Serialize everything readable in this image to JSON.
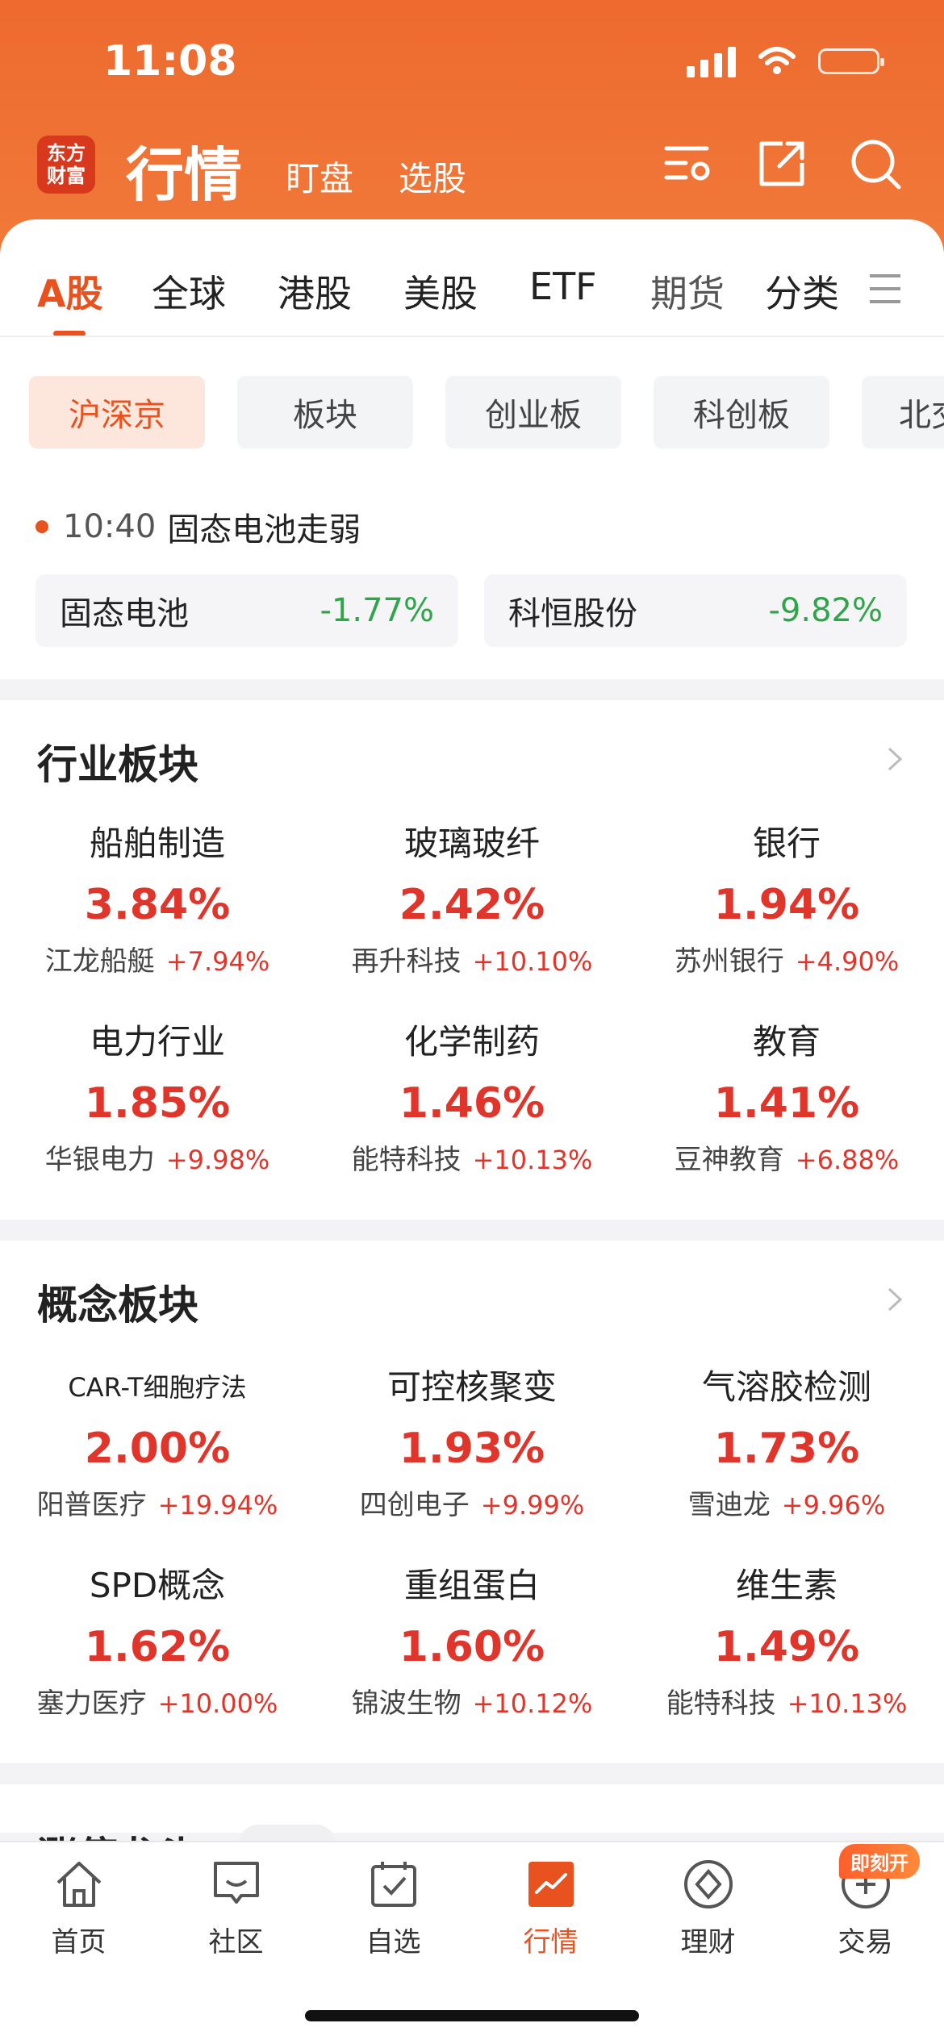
{
  "status_bar": {
    "time": "11:08"
  },
  "header": {
    "logo_line1": "东方",
    "logo_line2": "财富",
    "title": "行情",
    "sub1": "盯盘",
    "sub2": "选股"
  },
  "tabs": [
    {
      "label": "A股"
    },
    {
      "label": "全球"
    },
    {
      "label": "港股"
    },
    {
      "label": "美股"
    },
    {
      "label": "ETF"
    },
    {
      "label": "期货"
    },
    {
      "label": "分类"
    }
  ],
  "chips": [
    {
      "label": "沪深京"
    },
    {
      "label": "板块"
    },
    {
      "label": "创业板"
    },
    {
      "label": "科创板"
    },
    {
      "label": "北交"
    }
  ],
  "news": {
    "time": "10:40",
    "headline": "固态电池走弱",
    "cards": [
      {
        "name": "固态电池",
        "change": "-1.77%"
      },
      {
        "name": "科恒股份",
        "change": "-9.82%"
      }
    ]
  },
  "industry": {
    "title": "行业板块",
    "items": [
      {
        "name": "船舶制造",
        "pct": "3.84%",
        "leader": "江龙船艇",
        "leader_chg": "+7.94%"
      },
      {
        "name": "玻璃玻纤",
        "pct": "2.42%",
        "leader": "再升科技",
        "leader_chg": "+10.10%"
      },
      {
        "name": "银行",
        "pct": "1.94%",
        "leader": "苏州银行",
        "leader_chg": "+4.90%"
      },
      {
        "name": "电力行业",
        "pct": "1.85%",
        "leader": "华银电力",
        "leader_chg": "+9.98%"
      },
      {
        "name": "化学制药",
        "pct": "1.46%",
        "leader": "能特科技",
        "leader_chg": "+10.13%"
      },
      {
        "name": "教育",
        "pct": "1.41%",
        "leader": "豆神教育",
        "leader_chg": "+6.88%"
      }
    ]
  },
  "concept": {
    "title": "概念板块",
    "items": [
      {
        "name": "CAR-T细胞疗法",
        "pct": "2.00%",
        "leader": "阳普医疗",
        "leader_chg": "+19.94%"
      },
      {
        "name": "可控核聚变",
        "pct": "1.93%",
        "leader": "四创电子",
        "leader_chg": "+9.99%"
      },
      {
        "name": "气溶胶检测",
        "pct": "1.73%",
        "leader": "雪迪龙",
        "leader_chg": "+9.96%"
      },
      {
        "name": "SPD概念",
        "pct": "1.62%",
        "leader": "塞力医疗",
        "leader_chg": "+10.00%"
      },
      {
        "name": "重组蛋白",
        "pct": "1.60%",
        "leader": "锦波生物",
        "leader_chg": "+10.12%"
      },
      {
        "name": "维生素",
        "pct": "1.49%",
        "leader": "能特科技",
        "leader_chg": "+10.13%"
      }
    ]
  },
  "peek_section": {
    "title": "涨停龙头"
  },
  "bottom_nav": {
    "items": [
      {
        "label": "首页"
      },
      {
        "label": "社区"
      },
      {
        "label": "自选"
      },
      {
        "label": "行情"
      },
      {
        "label": "理财"
      },
      {
        "label": "交易"
      }
    ],
    "badge": "即刻开"
  },
  "colors": {
    "brand": "#e8521f",
    "up": "#e0352b",
    "down": "#2fa54a"
  }
}
